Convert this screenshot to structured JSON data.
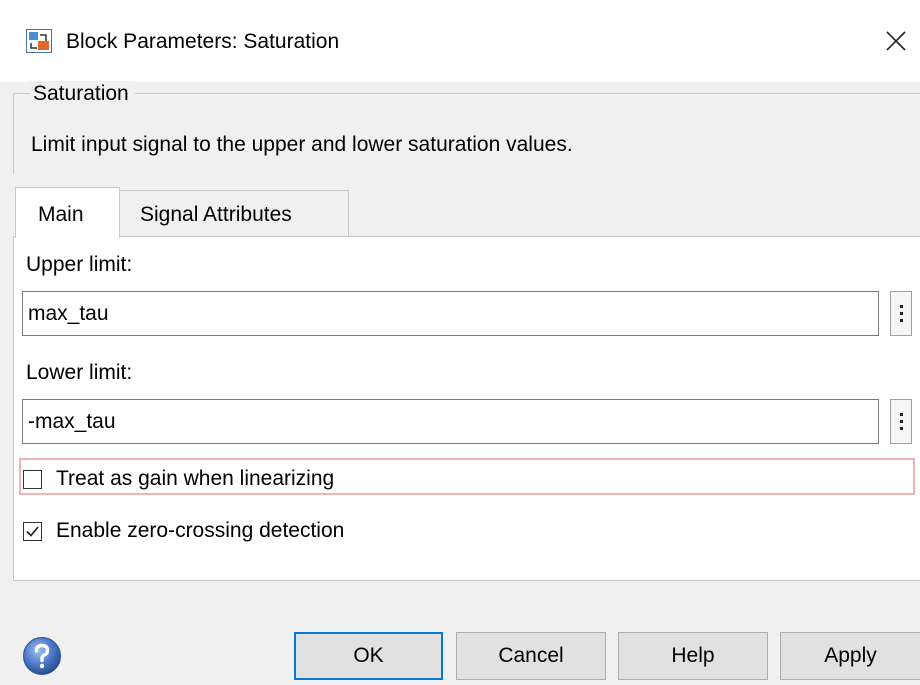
{
  "window": {
    "title": "Block Parameters: Saturation",
    "close_glyph": "✕"
  },
  "group": {
    "title": "Saturation",
    "description": "Limit input signal to the upper and lower saturation values."
  },
  "tabs": [
    {
      "label": "Main",
      "selected": true
    },
    {
      "label": "Signal Attributes",
      "selected": false
    }
  ],
  "params": {
    "upper_label": "Upper limit:",
    "upper_value": "max_tau",
    "lower_label": "Lower limit:",
    "lower_value": "-max_tau"
  },
  "checkboxes": [
    {
      "label": "Treat as gain when linearizing",
      "checked": false
    },
    {
      "label": "Enable zero-crossing detection",
      "checked": true
    }
  ],
  "buttons": {
    "ok": "OK",
    "cancel": "Cancel",
    "help": "Help",
    "apply": "Apply"
  },
  "icons": {
    "app": "simulink-block-icon",
    "help": "help-question-icon",
    "menu": "vertical-ellipsis-icon"
  },
  "colors": {
    "focus_border": "#0078d7",
    "highlight_border": "#f2b3b3",
    "help_icon": "#4a78c8"
  }
}
